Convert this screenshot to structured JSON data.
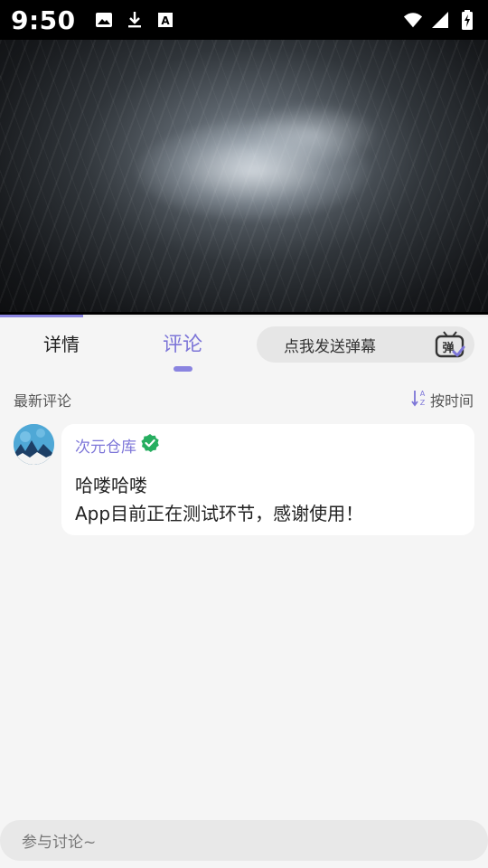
{
  "status_bar": {
    "time": "9:50",
    "left_icons": [
      "image-icon",
      "download-icon",
      "a-icon"
    ],
    "right_icons": [
      "wifi-icon",
      "signal-icon",
      "battery-icon"
    ]
  },
  "video": {
    "progress": 0.17
  },
  "tabs": {
    "details": "详情",
    "comments": "评论",
    "active": "comments"
  },
  "danmaku": {
    "placeholder": "点我发送弹幕",
    "icon_char": "弹"
  },
  "comments_section": {
    "title": "最新评论",
    "sort_label": "按时间"
  },
  "comments": [
    {
      "author": "次元仓库",
      "verified": true,
      "line1": "哈喽哈喽",
      "line2": "App目前正在测试环节，感谢使用！"
    }
  ],
  "input": {
    "placeholder": "参与讨论~"
  },
  "colors": {
    "accent": "#7d76d8",
    "verified": "#27ae60",
    "background": "#f5f5f5"
  }
}
